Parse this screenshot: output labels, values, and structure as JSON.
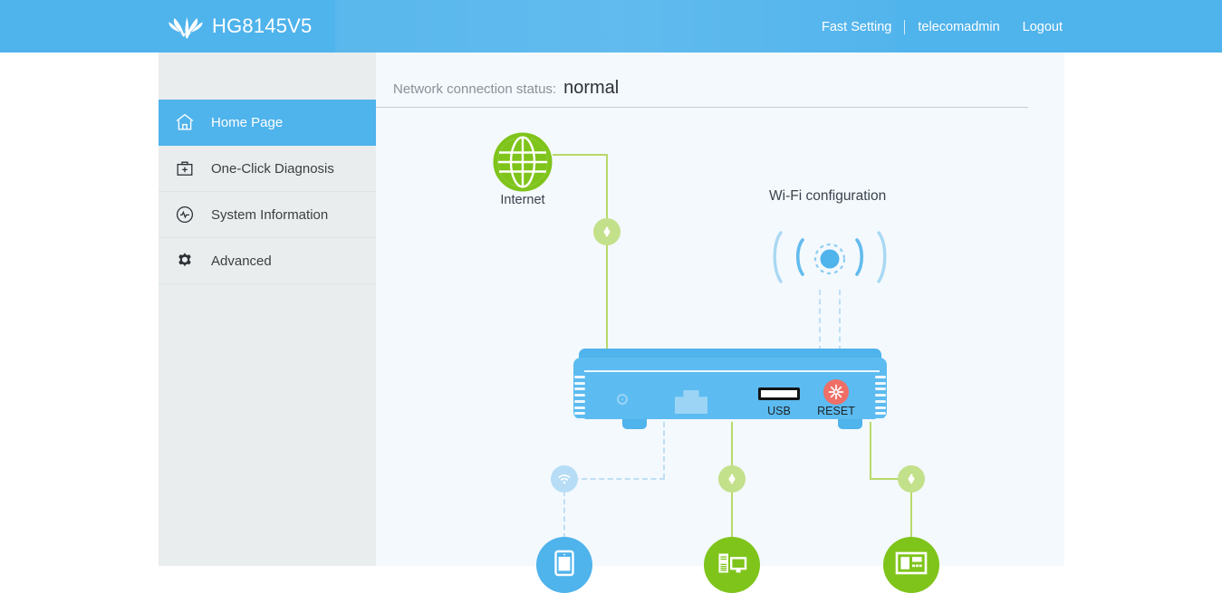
{
  "header": {
    "brand_title": "HG8145V5",
    "logo_icon": "huawei-flower-logo",
    "nav": {
      "fast_setting": "Fast Setting",
      "user": "telecomadmin",
      "logout": "Logout"
    }
  },
  "sidebar": {
    "items": [
      {
        "label": "Home Page",
        "icon": "home-icon",
        "active": true
      },
      {
        "label": "One-Click Diagnosis",
        "icon": "toolkit-plus-icon",
        "active": false
      },
      {
        "label": "System Information",
        "icon": "pulse-circle-icon",
        "active": false
      },
      {
        "label": "Advanced",
        "icon": "gear-icon",
        "active": false
      }
    ]
  },
  "main": {
    "status_label": "Network connection status:",
    "status_value": "normal",
    "topology": {
      "internet_label": "Internet",
      "wifi_title": "Wi-Fi configuration",
      "router": {
        "usb_label": "USB",
        "reset_label": "RESET",
        "reset_color": "#ef6f67",
        "body_color": "#5cbbf0"
      },
      "link_color": "#b8d96a",
      "wireless_link_color": "#bedff5",
      "nodes": [
        {
          "name": "internet-node",
          "icon": "globe-icon",
          "color": "#7fc41b"
        },
        {
          "name": "wifi-node",
          "icon": "wifi-signal-icon",
          "color": "#4fb3ec"
        },
        {
          "name": "tablet-device-node",
          "icon": "tablet-icon",
          "color": "#4fb3ec"
        },
        {
          "name": "desktop-device-node",
          "icon": "desktop-computer-icon",
          "color": "#7fc41b"
        },
        {
          "name": "monitor-device-node",
          "icon": "monitor-icon",
          "color": "#7fc41b"
        }
      ]
    }
  }
}
